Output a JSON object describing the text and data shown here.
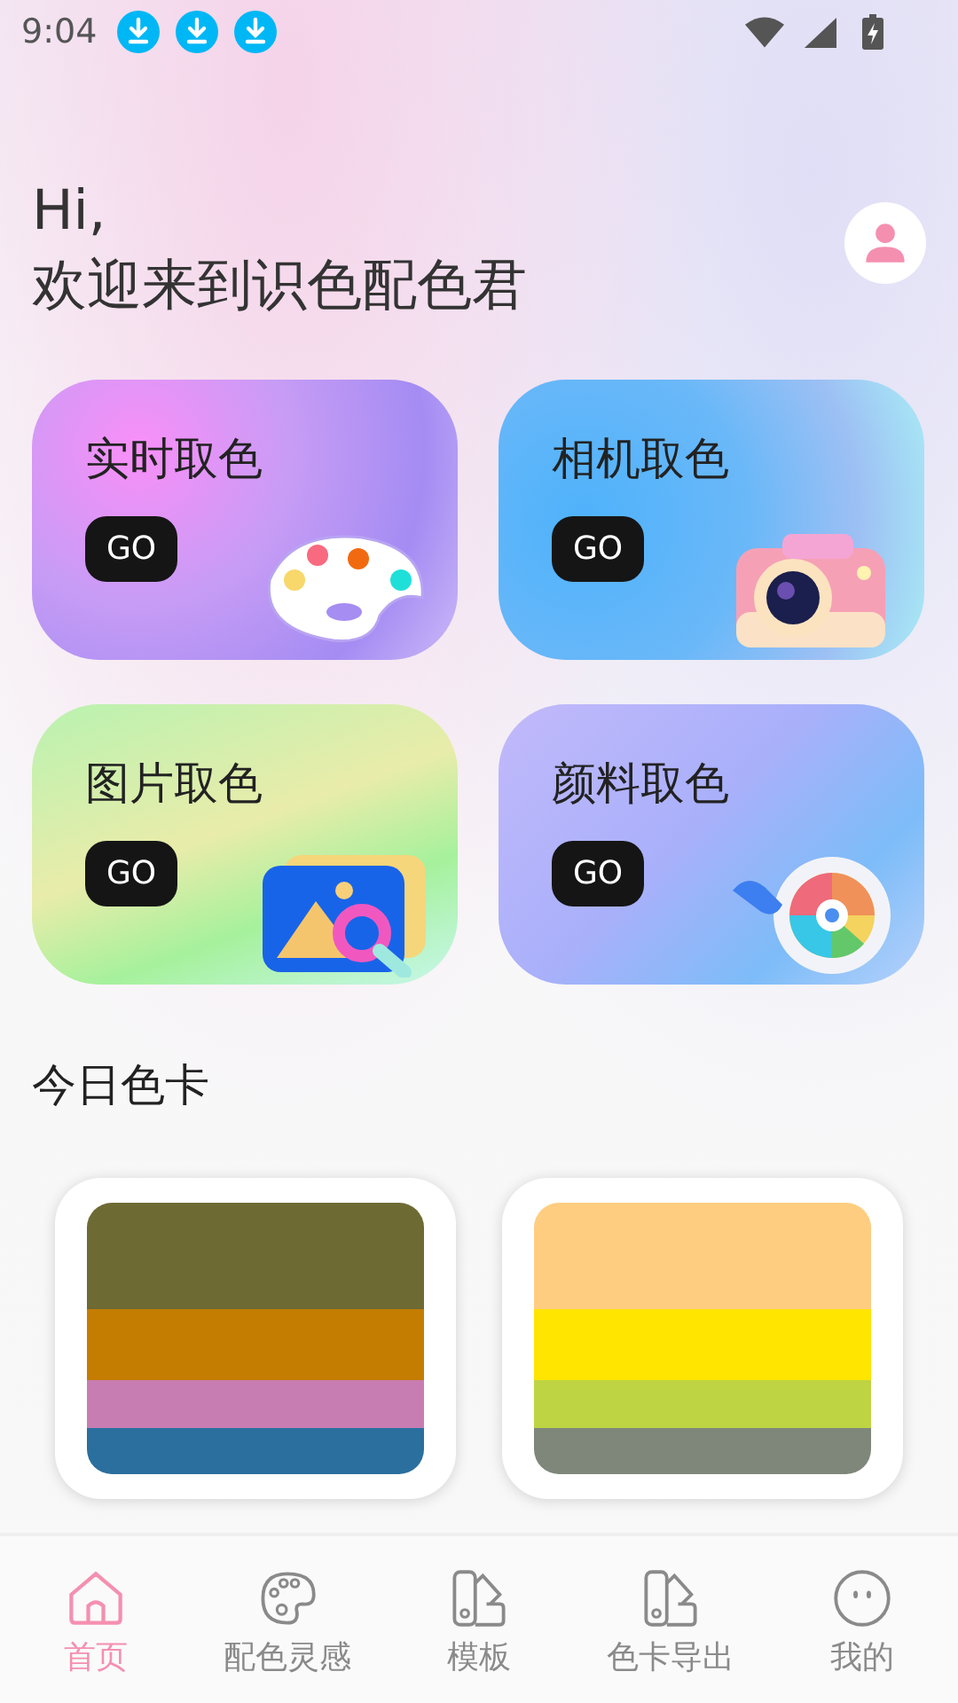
{
  "status_bar": {
    "time": "9:04",
    "notifications": [
      {
        "kind": "download"
      },
      {
        "kind": "download"
      },
      {
        "kind": "download"
      }
    ]
  },
  "greeting": {
    "line1": "Hi,",
    "line2": "欢迎来到识色配色君"
  },
  "features": [
    {
      "title": "实时取色",
      "button": "GO",
      "kind": "palette"
    },
    {
      "title": "相机取色",
      "button": "GO",
      "kind": "camera"
    },
    {
      "title": "图片取色",
      "button": "GO",
      "kind": "image"
    },
    {
      "title": "颜料取色",
      "button": "GO",
      "kind": "paint"
    }
  ],
  "today": {
    "title": "今日色卡",
    "cards": [
      {
        "colors": [
          {
            "color": "#6e6a33"
          },
          {
            "color": "#c47d00"
          },
          {
            "color": "#c87db2"
          },
          {
            "color": "#2a6f9e"
          }
        ]
      },
      {
        "colors": [
          {
            "color": "#ffcd80"
          },
          {
            "color": "#ffe500"
          },
          {
            "color": "#bed443"
          },
          {
            "color": "#7e877a"
          }
        ]
      }
    ]
  },
  "tabs": [
    {
      "label": "首页",
      "kind": "home",
      "selected": true
    },
    {
      "label": "配色灵感",
      "kind": "palette",
      "selected": false
    },
    {
      "label": "模板",
      "kind": "swatch",
      "selected": false
    },
    {
      "label": "色卡导出",
      "kind": "swatch",
      "selected": false
    },
    {
      "label": "我的",
      "kind": "face",
      "selected": false
    }
  ]
}
